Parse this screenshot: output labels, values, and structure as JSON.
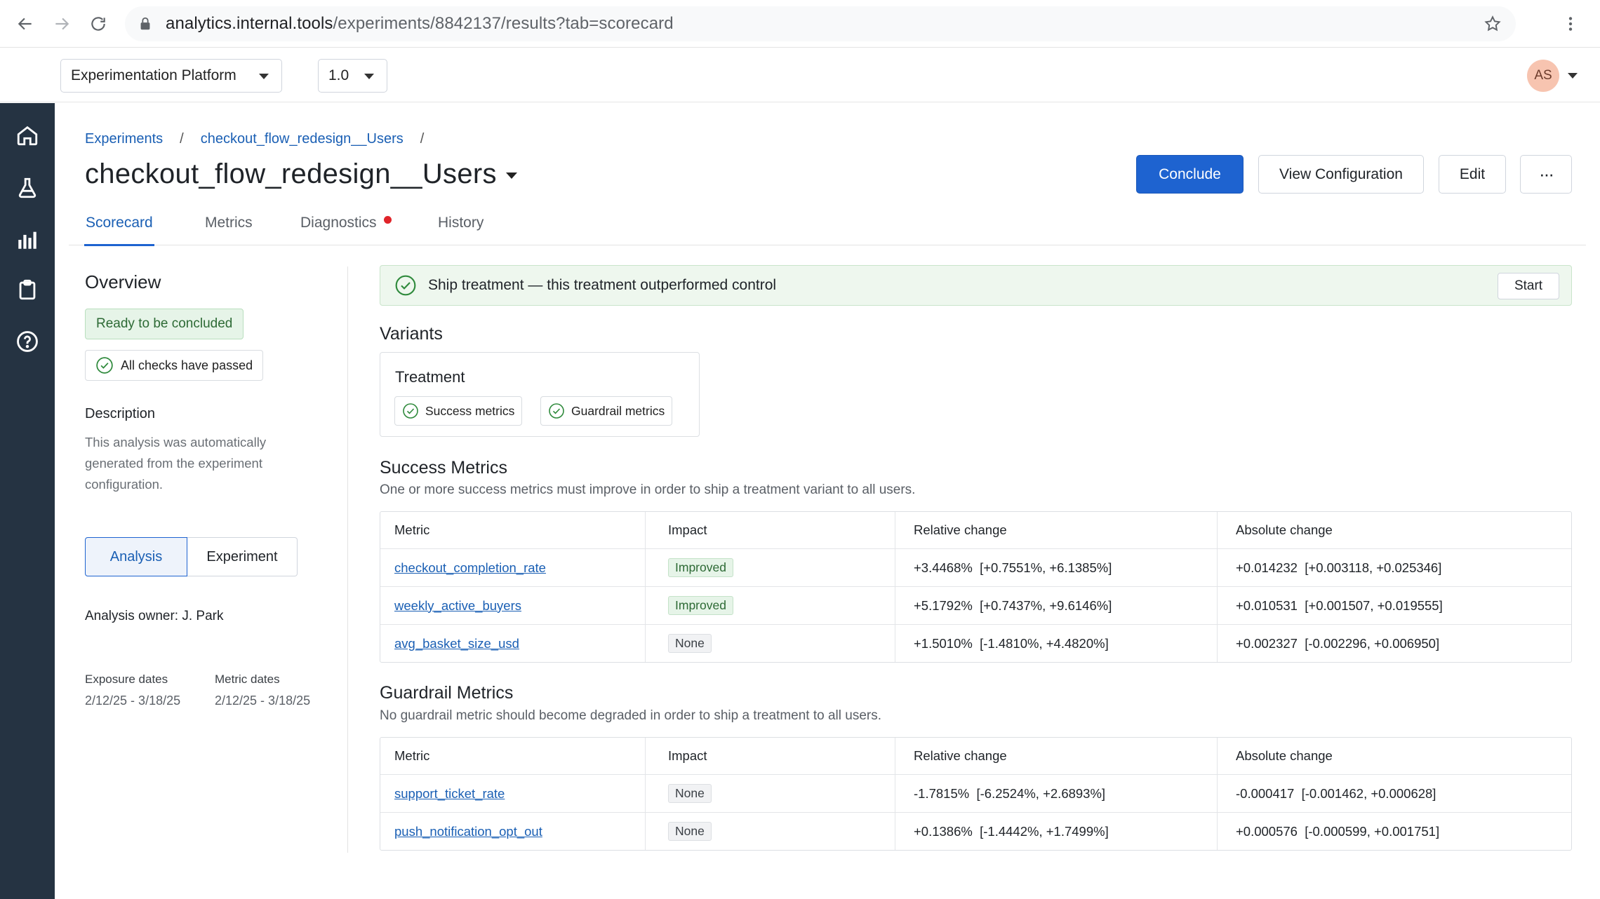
{
  "browser": {
    "url_host": "analytics.internal.tools",
    "url_path": "/experiments/8842137/results?tab=scorecard"
  },
  "header": {
    "platform_select": "Experimentation Platform",
    "version_select": "1.0",
    "avatar_initials": "AS"
  },
  "breadcrumb": {
    "root": "Experiments",
    "current": "checkout_flow_redesign__Users",
    "separator": "/"
  },
  "page": {
    "title": "checkout_flow_redesign__Users"
  },
  "actions": {
    "conclude": "Conclude",
    "view_configuration": "View Configuration",
    "edit": "Edit",
    "more": "···"
  },
  "tabs": [
    {
      "label": "Scorecard",
      "active": true
    },
    {
      "label": "Metrics",
      "active": false
    },
    {
      "label": "Diagnostics",
      "active": false,
      "alert_dot_color": "#e0242a"
    },
    {
      "label": "History",
      "active": false
    }
  ],
  "overview": {
    "title": "Overview",
    "status_badge": "Ready to be concluded",
    "checks_badge": "All checks have passed",
    "description_title": "Description",
    "description_text": "This analysis was automatically generated from the experiment configuration.",
    "toggle": {
      "analysis": "Analysis",
      "experiment": "Experiment",
      "selected": "Analysis"
    },
    "owner": "Analysis owner: J. Park",
    "exposure_label": "Exposure dates",
    "exposure_value": "2/12/25 - 3/18/25",
    "metric_dates_label": "Metric dates",
    "metric_dates_value": "2/12/25 - 3/18/25"
  },
  "ship_banner": {
    "text": "Ship treatment — this treatment outperformed control",
    "button": "Start"
  },
  "variants": {
    "title": "Variants",
    "name": "Treatment",
    "chip_success": "Success metrics",
    "chip_guardrail": "Guardrail metrics"
  },
  "success_metrics": {
    "title": "Success Metrics",
    "subtitle": "One or more success metrics must improve in order to ship a treatment variant to all users.",
    "columns": [
      "Metric",
      "Impact",
      "Relative change",
      "Absolute change"
    ],
    "rows": [
      {
        "metric": "checkout_completion_rate",
        "impact": "Improved",
        "relative": "+3.4468%  [+0.7551%, +6.1385%]",
        "absolute": "+0.014232  [+0.003118, +0.025346]"
      },
      {
        "metric": "weekly_active_buyers",
        "impact": "Improved",
        "relative": "+5.1792%  [+0.7437%, +9.6146%]",
        "absolute": "+0.010531  [+0.001507, +0.019555]"
      },
      {
        "metric": "avg_basket_size_usd",
        "impact": "None",
        "relative": "+1.5010%  [-1.4810%, +4.4820%]",
        "absolute": "+0.002327  [-0.002296, +0.006950]"
      }
    ]
  },
  "guardrail_metrics": {
    "title": "Guardrail Metrics",
    "subtitle": "No guardrail metric should become degraded in order to ship a treatment to all users.",
    "columns": [
      "Metric",
      "Impact",
      "Relative change",
      "Absolute change"
    ],
    "rows": [
      {
        "metric": "support_ticket_rate",
        "impact": "None",
        "relative": "-1.7815%  [-6.2524%, +2.6893%]",
        "absolute": "-0.000417  [-0.001462, +0.000628]"
      },
      {
        "metric": "push_notification_opt_out",
        "impact": "None",
        "relative": "+0.1386%  [-1.4442%, +1.7499%]",
        "absolute": "+0.000576  [-0.000599, +0.001751]"
      }
    ]
  },
  "icons": {
    "rail": [
      "home-icon",
      "flask-icon",
      "bar-chart-icon",
      "clipboard-icon",
      "help-icon"
    ],
    "check": "check-circle-icon"
  },
  "colors": {
    "primary": "#1e63d0",
    "rail_bg": "#253342",
    "success_green": "#2f8a3c",
    "alert_red": "#e0242a"
  }
}
